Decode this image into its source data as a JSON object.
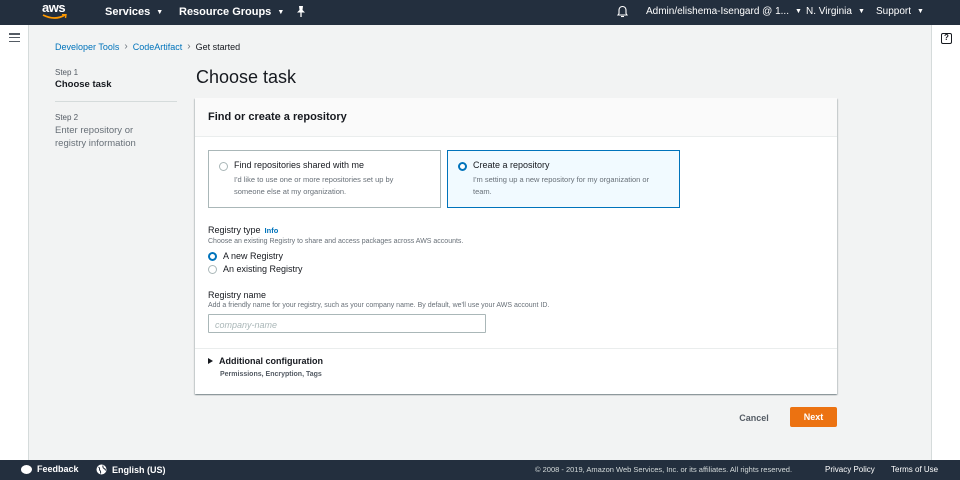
{
  "topnav": {
    "logo": "aws",
    "services_label": "Services",
    "resource_groups_label": "Resource Groups",
    "user_label": "Admin/elishema-Isengard @ 1...",
    "region_label": "N. Virginia",
    "support_label": "Support"
  },
  "breadcrumb": {
    "items": [
      "Developer Tools",
      "CodeArtifact"
    ],
    "current": "Get started"
  },
  "steps": [
    {
      "num": "Step 1",
      "title": "Choose task"
    },
    {
      "num": "Step 2",
      "title": "Enter repository or registry information"
    }
  ],
  "page_title": "Choose task",
  "panel": {
    "title": "Find or create a repository",
    "tiles": [
      {
        "label": "Find repositories shared with me",
        "desc": "I'd like to use one or more repositories set up by someone else at my organization.",
        "selected": false
      },
      {
        "label": "Create a repository",
        "desc": "I'm setting up a new repository for my organization or team.",
        "selected": true
      }
    ],
    "registry_type": {
      "label": "Registry type",
      "info": "Info",
      "desc": "Choose an existing Registry to share and access packages across AWS accounts.",
      "options": [
        {
          "label": "A new Registry",
          "checked": true
        },
        {
          "label": "An existing Registry",
          "checked": false
        }
      ]
    },
    "registry_name": {
      "label": "Registry name",
      "desc": "Add a friendly name for your registry, such as your company name. By default, we'll use your AWS account ID.",
      "placeholder": "company-name",
      "value": ""
    },
    "additional": {
      "label": "Additional configuration",
      "sub": "Permissions, Encryption, Tags"
    }
  },
  "actions": {
    "cancel": "Cancel",
    "next": "Next"
  },
  "footer": {
    "feedback": "Feedback",
    "language": "English (US)",
    "copyright": "© 2008 - 2019, Amazon Web Services, Inc. or its affiliates. All rights reserved.",
    "privacy": "Privacy Policy",
    "terms": "Terms of Use"
  },
  "colors": {
    "nav_bg": "#232f3e",
    "link": "#0073bb",
    "primary_button": "#ec7211",
    "selected_tile_bg": "#f1faff"
  }
}
